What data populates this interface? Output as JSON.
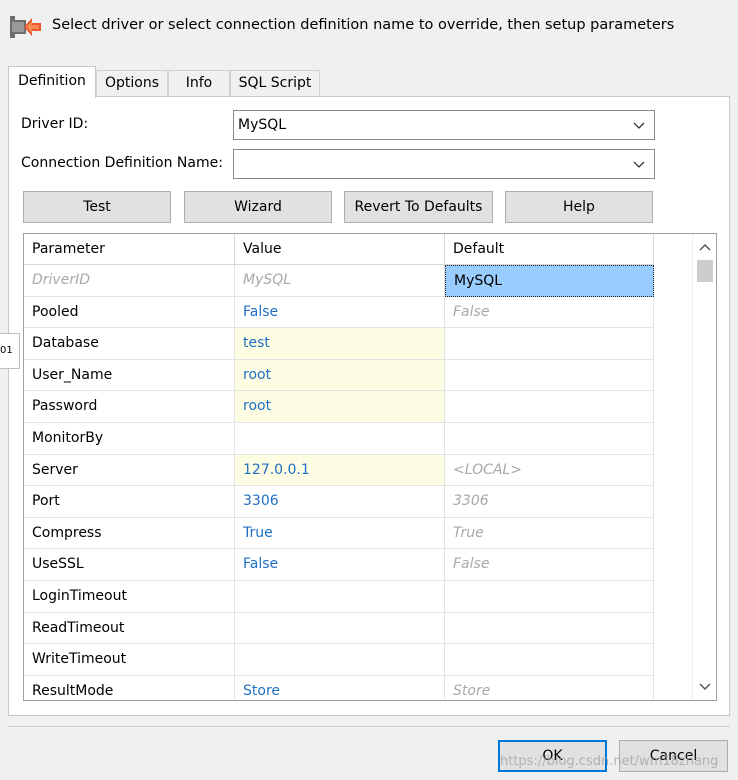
{
  "header": {
    "text": "Select driver or select connection definition name to override, then setup parameters",
    "icon": "plug-arrow-icon"
  },
  "tabs": [
    {
      "label": "Definition",
      "active": true
    },
    {
      "label": "Options"
    },
    {
      "label": "Info"
    },
    {
      "label": "SQL Script"
    }
  ],
  "form": {
    "driver_id_label": "Driver ID:",
    "driver_id_value": "MySQL",
    "conn_def_label": "Connection Definition Name:",
    "conn_def_value": ""
  },
  "buttons": {
    "test": "Test",
    "wizard": "Wizard",
    "revert": "Revert To Defaults",
    "help": "Help"
  },
  "grid": {
    "columns": [
      "Parameter",
      "Value",
      "Default"
    ],
    "rows": [
      {
        "param": "DriverID",
        "value": "MySQL",
        "default": "MySQL",
        "readonly": true
      },
      {
        "param": "Pooled",
        "value": "False",
        "default": "False"
      },
      {
        "param": "Database",
        "value": "test",
        "default": ""
      },
      {
        "param": "User_Name",
        "value": "root",
        "default": ""
      },
      {
        "param": "Password",
        "value": "root",
        "default": ""
      },
      {
        "param": "MonitorBy",
        "value": "",
        "default": ""
      },
      {
        "param": "Server",
        "value": "127.0.0.1",
        "default": "<LOCAL>"
      },
      {
        "param": "Port",
        "value": "3306",
        "default": "3306"
      },
      {
        "param": "Compress",
        "value": "True",
        "default": "True"
      },
      {
        "param": "UseSSL",
        "value": "False",
        "default": "False"
      },
      {
        "param": "LoginTimeout",
        "value": "",
        "default": ""
      },
      {
        "param": "ReadTimeout",
        "value": "",
        "default": ""
      },
      {
        "param": "WriteTimeout",
        "value": "",
        "default": ""
      },
      {
        "param": "ResultMode",
        "value": "Store",
        "default": "Store"
      }
    ]
  },
  "dialog": {
    "ok": "OK",
    "cancel": "Cancel"
  },
  "side_tag": "01",
  "watermark": "https://blog.csdn.net/wm18zhang",
  "colors": {
    "value_text": "#1f6fc4",
    "highlight_bg": "#fdfde4",
    "selection_bg": "#99ccff",
    "default_button_border": "#0078d7"
  }
}
